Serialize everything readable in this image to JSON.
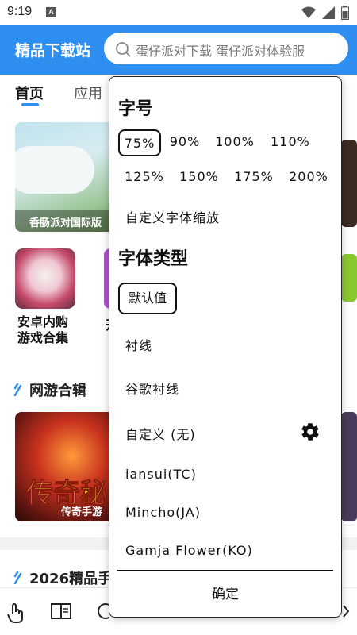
{
  "status_bar": {
    "time": "9:19",
    "notif_badge": "A"
  },
  "header": {
    "title": "精品下载站",
    "search_placeholder": "蛋仔派对下载 蛋仔派对体验服"
  },
  "tabs": [
    {
      "label": "首页",
      "active": true
    },
    {
      "label": "应用",
      "active": false
    }
  ],
  "banner": {
    "caption": "香肠派对国际版"
  },
  "categories": [
    {
      "label_line1": "安卓内购",
      "label_line2": "游戏合集"
    },
    {
      "label_fragment": "开"
    }
  ],
  "sections": {
    "online_games": "网游合辑",
    "featured": "2026精品手"
  },
  "legend_card": {
    "title": "传奇秘",
    "subtitle": "传奇手游"
  },
  "font_menu": {
    "size_heading": "字号",
    "size_options": [
      "75%",
      "90%",
      "100%",
      "110%",
      "125%",
      "150%",
      "175%",
      "200%"
    ],
    "selected_size": "75%",
    "custom_scale_label": "自定义字体缩放",
    "type_heading": "字体类型",
    "selected_type": "默认值",
    "type_options": [
      "衬线",
      "谷歌衬线",
      "自定义 (无)",
      "iansui(TC)",
      "Mincho(JA)",
      "Gamja Flower(KO)"
    ],
    "confirm_label": "确定"
  },
  "colors": {
    "accent": "#2f8ff0"
  }
}
